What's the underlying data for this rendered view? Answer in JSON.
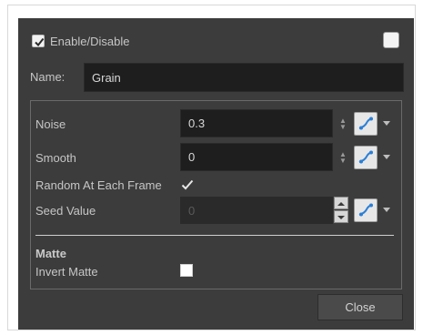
{
  "header": {
    "enable_label": "Enable/Disable"
  },
  "name_row": {
    "label": "Name:",
    "value": "Grain"
  },
  "params": {
    "noise": {
      "label": "Noise",
      "value": "0.3"
    },
    "smooth": {
      "label": "Smooth",
      "value": "0"
    },
    "random": {
      "label": "Random At Each Frame"
    },
    "seed": {
      "label": "Seed Value",
      "value": "0"
    }
  },
  "matte": {
    "title": "Matte",
    "invert_label": "Invert Matte"
  },
  "footer": {
    "close_label": "Close"
  },
  "colors": {
    "dialog_bg": "#3c3c3c",
    "field_bg": "#1e1e1e",
    "accent_blue": "#2b7fd6"
  }
}
